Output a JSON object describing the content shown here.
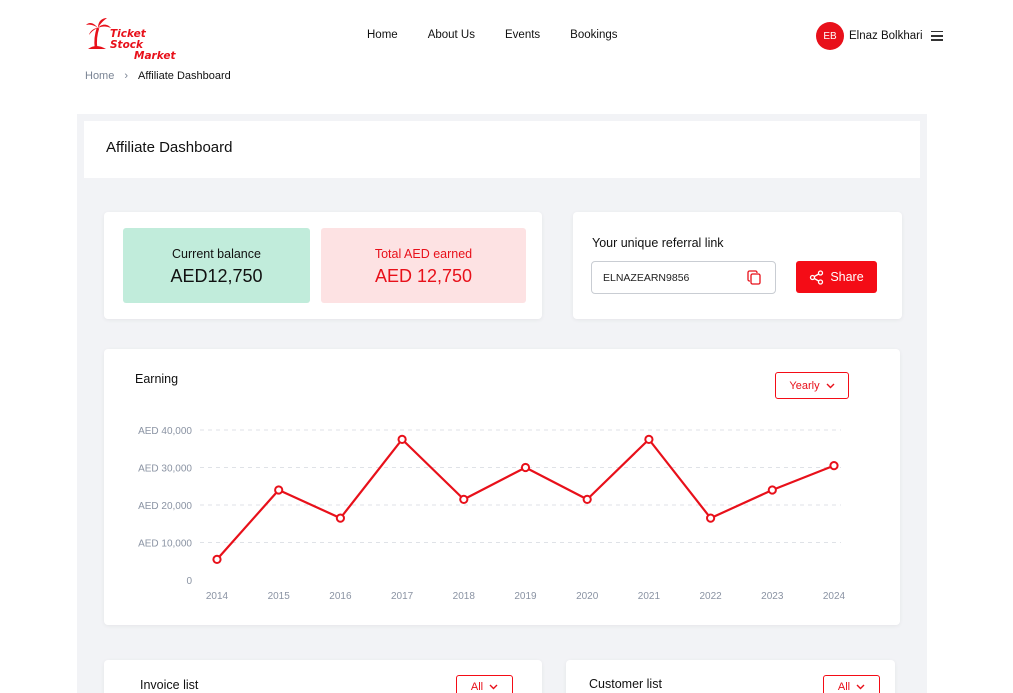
{
  "logo": {
    "line1": "Ticket Stock",
    "line2": "Market"
  },
  "nav": {
    "items": [
      "Home",
      "About Us",
      "Events",
      "Bookings"
    ]
  },
  "user": {
    "initials": "EB",
    "name": "Elnaz Bolkhari"
  },
  "breadcrumb": {
    "home": "Home",
    "current": "Affiliate Dashboard"
  },
  "page_title": "Affiliate Dashboard",
  "balance": {
    "current_label": "Current balance",
    "current_value": "AED12,750",
    "earned_label": "Total AED earned",
    "earned_value": "AED 12,750"
  },
  "referral": {
    "title": "Your unique referral link",
    "code": "ELNAZEARN9856",
    "share_label": "Share"
  },
  "earning": {
    "title": "Earning",
    "period": "Yearly"
  },
  "chart_data": {
    "type": "line",
    "categories": [
      "2014",
      "2015",
      "2016",
      "2017",
      "2018",
      "2019",
      "2020",
      "2021",
      "2022",
      "2023",
      "2024"
    ],
    "values": [
      5500,
      24000,
      16500,
      37500,
      21500,
      30000,
      21500,
      37500,
      16500,
      24000,
      30500
    ],
    "ylim": [
      0,
      40000
    ],
    "yticks": [
      0,
      10000,
      20000,
      30000,
      40000
    ],
    "ytick_labels": [
      "0",
      "AED 10,000",
      "AED 20,000",
      "AED 30,000",
      "AED 40,000"
    ],
    "grid": true,
    "color": "#e8101a"
  },
  "invoice": {
    "title": "Invoice list",
    "filter": "All"
  },
  "customer": {
    "title": "Customer list",
    "filter": "All"
  },
  "colors": {
    "brand_red": "#e8101a",
    "green_bg": "#c1ecdb",
    "pink_bg": "#fde2e3"
  }
}
